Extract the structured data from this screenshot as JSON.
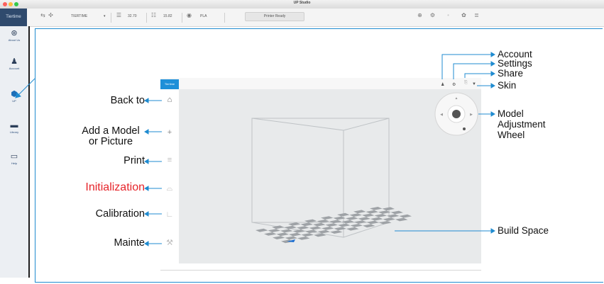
{
  "window": {
    "title": "UP Studio",
    "brand": "Tiertime"
  },
  "toolbar": {
    "printer_name": "TIERTIME",
    "nozzle_temp": "32.70",
    "bed_temp": "15.82",
    "material": "PLA",
    "status": "Printer Ready"
  },
  "sidebar": {
    "items": [
      {
        "label": "About Us",
        "icon": "compass-icon"
      },
      {
        "label": "Account",
        "icon": "user-icon"
      },
      {
        "label": "UP",
        "icon": "cube-icon"
      },
      {
        "label": "Library",
        "icon": "folder-icon"
      },
      {
        "label": "Help",
        "icon": "book-icon"
      }
    ]
  },
  "inner_app": {
    "brand": "Tiertime"
  },
  "annotations": {
    "back_to": "Back to",
    "add_model_line1": "Add a Model",
    "add_model_line2": "or Picture",
    "print": "Print",
    "initialization": "Initialization",
    "calibration": "Calibration",
    "mainte": "Mainte",
    "account": "Account",
    "settings": "Settings",
    "share": "Share",
    "skin": "Skin",
    "wheel_line1": "Model",
    "wheel_line2": "Adjustment",
    "wheel_line3": "Wheel",
    "build_space": "Build Space"
  },
  "colors": {
    "annotation_blue": "#1f8bd0",
    "highlight_red": "#e6242a",
    "brand_blue": "#1e8fd8",
    "sidebar_icon": "#2b3e59"
  }
}
